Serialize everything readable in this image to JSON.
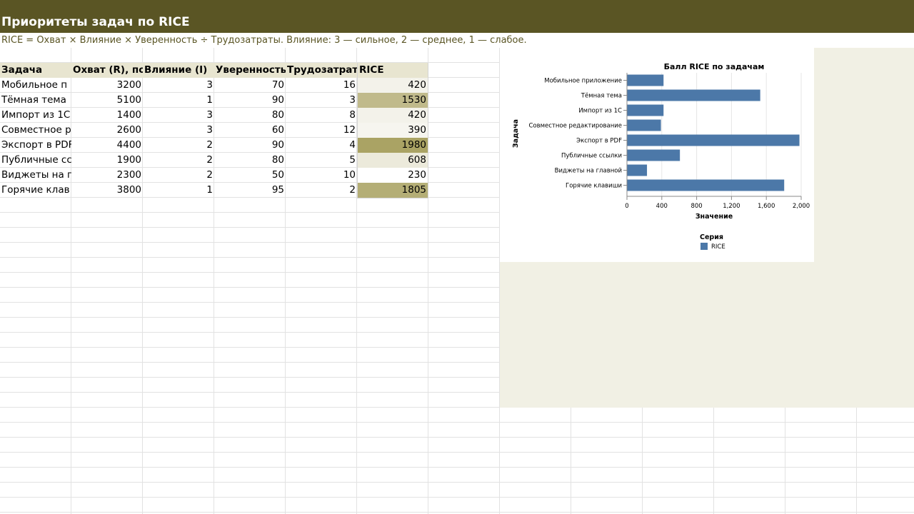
{
  "sheet": {
    "title": "Приоритеты задач по RICE",
    "subtitle": "RICE = Охват × Влияние × Уверенность ÷ Трудозатраты. Влияние: 3 — сильное, 2 — среднее, 1 — слабое."
  },
  "table": {
    "headers": [
      "Задача",
      "Охват (R), по",
      "Влияние (I)",
      "Уверенность",
      "Трудозатрат",
      "RICE"
    ],
    "rows": [
      {
        "task": "Мобильное п",
        "reach": "3200",
        "impact": "3",
        "confidence": "70",
        "effort": "16",
        "rice": "420",
        "fill": "#f3f2ea"
      },
      {
        "task": "Тёмная тема",
        "reach": "5100",
        "impact": "1",
        "confidence": "90",
        "effort": "3",
        "rice": "1530",
        "fill": "#c0ba8b"
      },
      {
        "task": "Импорт из 1С",
        "reach": "1400",
        "impact": "3",
        "confidence": "80",
        "effort": "8",
        "rice": "420",
        "fill": "#f3f2ea"
      },
      {
        "task": "Совместное р",
        "reach": "2600",
        "impact": "3",
        "confidence": "60",
        "effort": "12",
        "rice": "390",
        "fill": "#f6f5ef"
      },
      {
        "task": "Экспорт в PDF",
        "reach": "4400",
        "impact": "2",
        "confidence": "90",
        "effort": "4",
        "rice": "1980",
        "fill": "#aaa364"
      },
      {
        "task": "Публичные сс",
        "reach": "1900",
        "impact": "2",
        "confidence": "80",
        "effort": "5",
        "rice": "608",
        "fill": "#eceadb"
      },
      {
        "task": "Виджеты на г",
        "reach": "2300",
        "impact": "2",
        "confidence": "50",
        "effort": "10",
        "rice": "230",
        "fill": "#ffffff"
      },
      {
        "task": "Горячие клав",
        "reach": "3800",
        "impact": "1",
        "confidence": "95",
        "effort": "2",
        "rice": "1805",
        "fill": "#b4ae76"
      }
    ]
  },
  "chart_data": {
    "type": "bar",
    "orientation": "horizontal",
    "title": "Балл RICE по задачам",
    "xlabel": "Значение",
    "ylabel": "Задача",
    "categories": [
      "Мобильное приложение",
      "Тёмная тема",
      "Импорт из 1С",
      "Совместное редактирование",
      "Экспорт в PDF",
      "Публичные ссылки",
      "Виджеты на главной",
      "Горячие клавиши"
    ],
    "series": [
      {
        "name": "RICE",
        "values": [
          420,
          1530,
          420,
          390,
          1980,
          608,
          230,
          1805
        ]
      }
    ],
    "xlim": [
      0,
      2000
    ],
    "xticks": [
      "0",
      "400",
      "800",
      "1,200",
      "1,600",
      "2,000"
    ],
    "grid": true,
    "legend": {
      "title": "Серия",
      "position": "bottom",
      "items": [
        "RICE"
      ]
    },
    "colors": {
      "bar": "#4c78a8"
    }
  }
}
